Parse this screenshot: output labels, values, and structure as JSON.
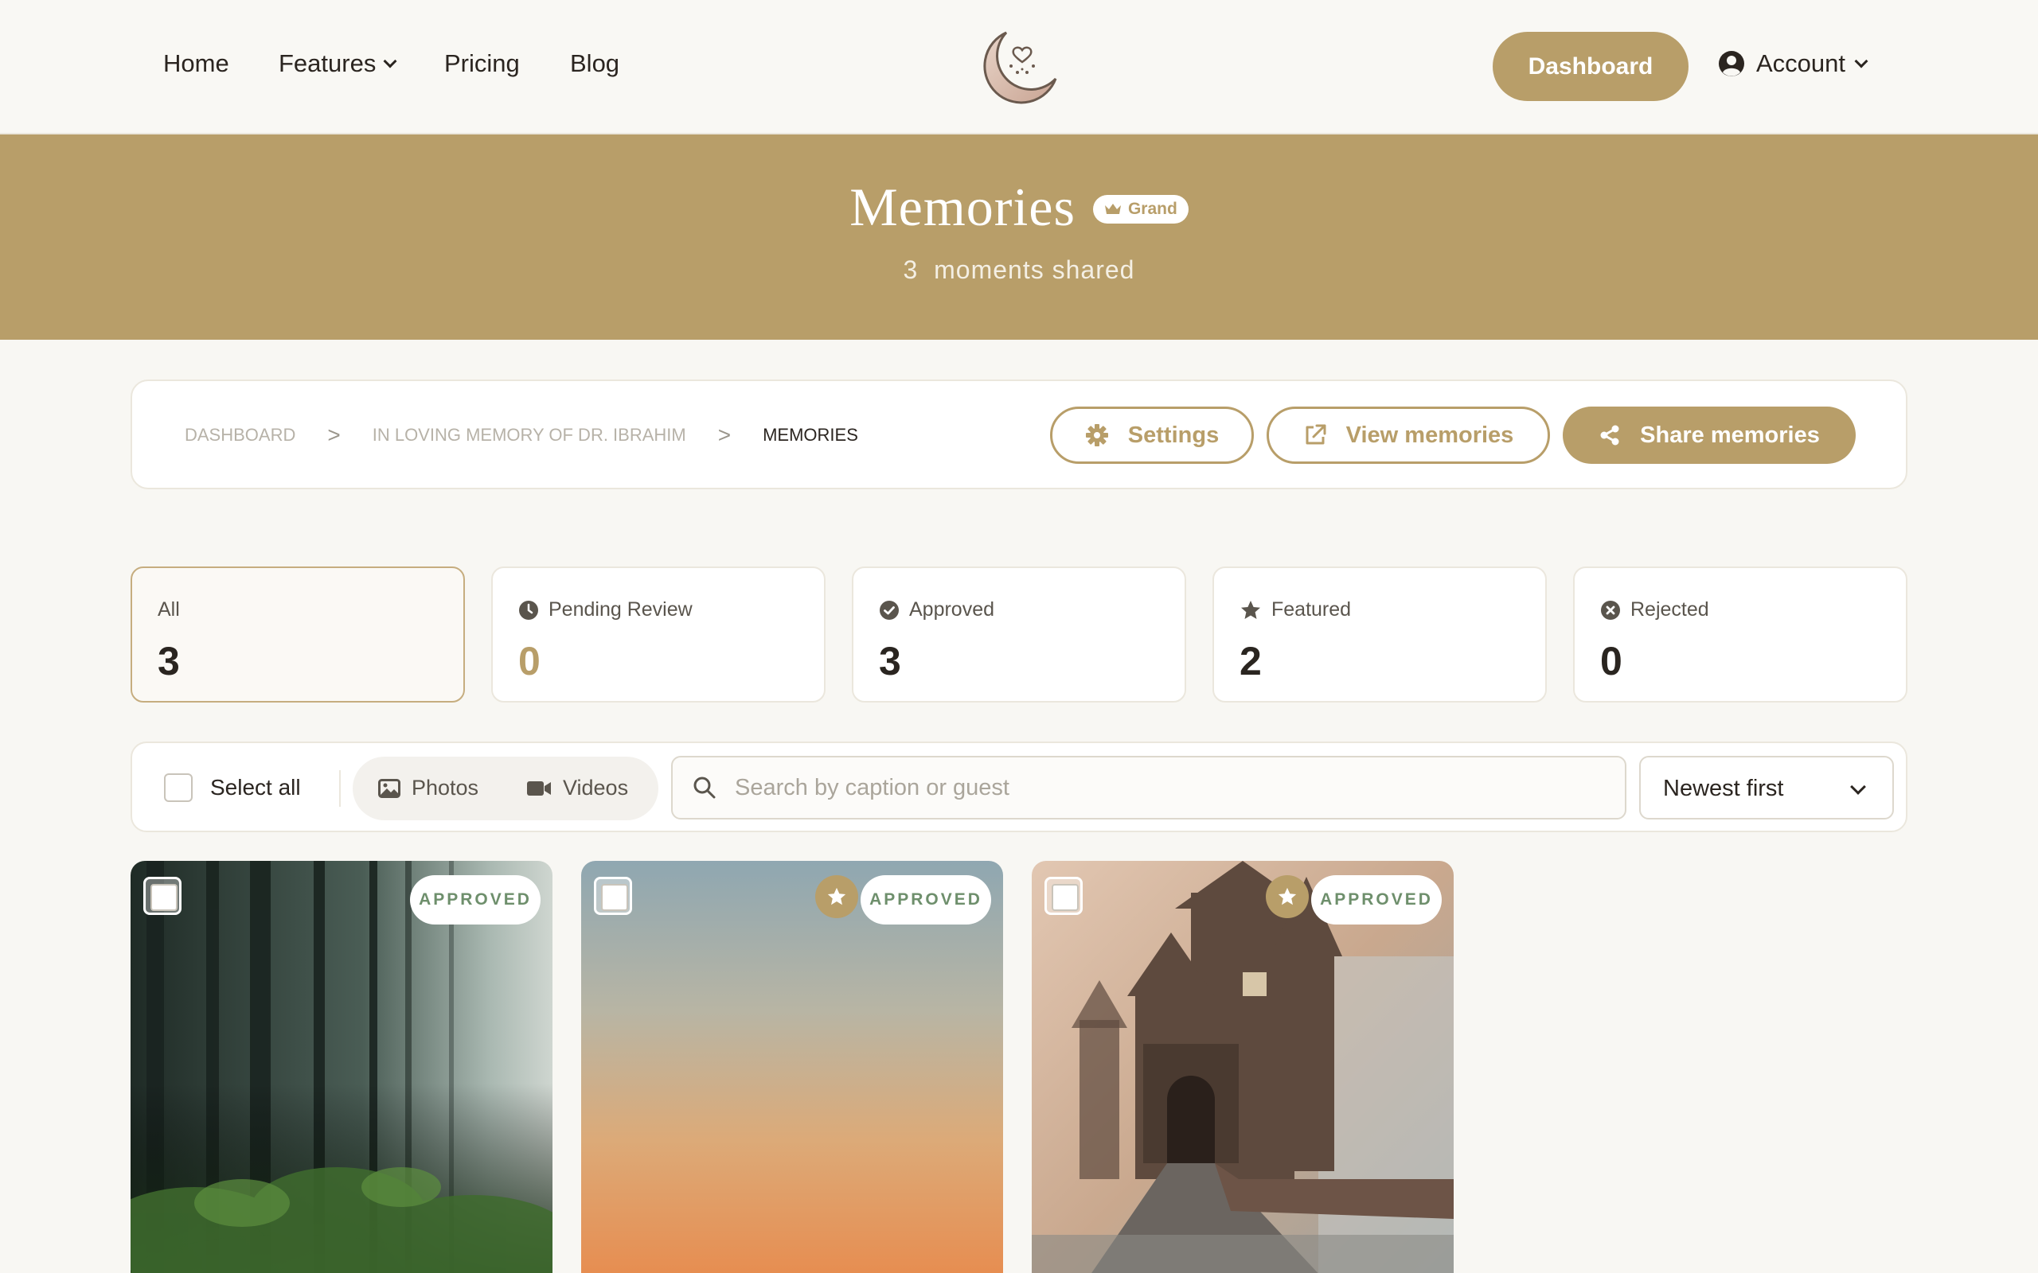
{
  "nav": {
    "home": "Home",
    "features": "Features",
    "pricing": "Pricing",
    "blog": "Blog",
    "dashboard": "Dashboard",
    "account": "Account"
  },
  "hero": {
    "title": "Memories",
    "badge": "Grand",
    "count": "3",
    "subtitle": "moments shared"
  },
  "breadcrumb": {
    "items": [
      "DASHBOARD",
      "IN LOVING MEMORY OF DR. IBRAHIM",
      "MEMORIES"
    ],
    "separator": ">"
  },
  "actions": {
    "settings": "Settings",
    "view": "View memories",
    "share": "Share memories"
  },
  "stats": [
    {
      "label": "All",
      "value": "3"
    },
    {
      "label": "Pending Review",
      "value": "0"
    },
    {
      "label": "Approved",
      "value": "3"
    },
    {
      "label": "Featured",
      "value": "2"
    },
    {
      "label": "Rejected",
      "value": "0"
    }
  ],
  "filters": {
    "select_all": "Select all",
    "photos": "Photos",
    "videos": "Videos",
    "search_placeholder": "Search by caption or guest",
    "sort": "Newest first"
  },
  "media": [
    {
      "status": "APPROVED",
      "featured": false,
      "subject": "misty forest"
    },
    {
      "status": "APPROVED",
      "featured": true,
      "subject": "sunset gradient sky"
    },
    {
      "status": "APPROVED",
      "featured": true,
      "subject": "castle in fog"
    }
  ],
  "colors": {
    "accent": "#b89e69",
    "background": "#f8f7f3",
    "approved_text": "#6e8f6c"
  }
}
